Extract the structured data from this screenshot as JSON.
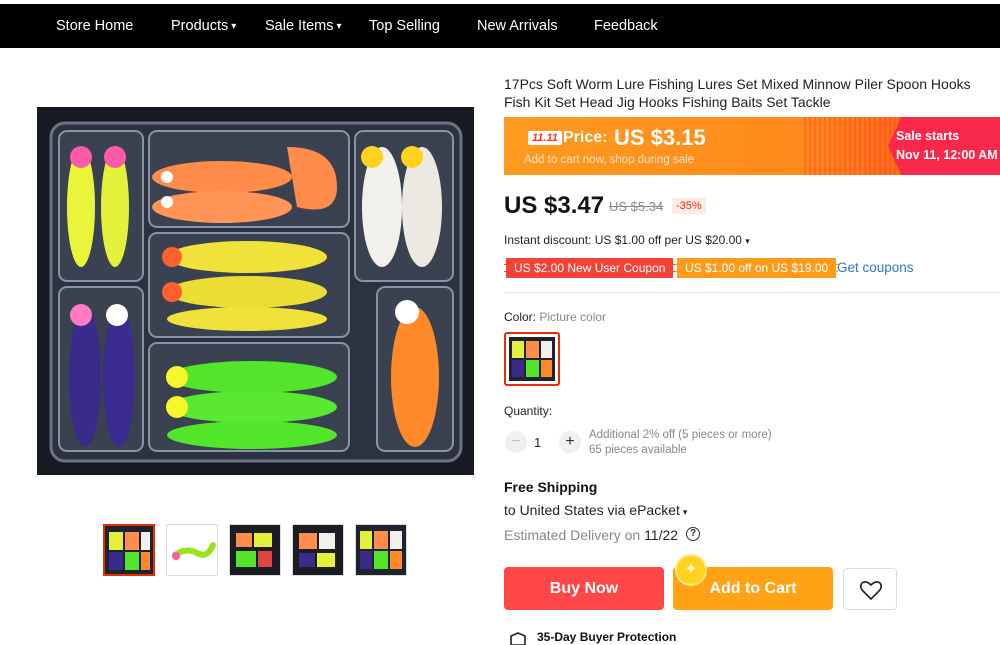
{
  "nav": {
    "items": [
      {
        "label": "Store Home",
        "dropdown": false
      },
      {
        "label": "Products",
        "dropdown": true
      },
      {
        "label": "Sale Items",
        "dropdown": true
      },
      {
        "label": "Top Selling",
        "dropdown": false
      },
      {
        "label": "New Arrivals",
        "dropdown": false
      },
      {
        "label": "Feedback",
        "dropdown": false
      }
    ]
  },
  "gallery": {
    "thumbnail_count": 5,
    "selected_index": 0
  },
  "product": {
    "title": "17Pcs Soft Worm Lure Fishing Lures Set Mixed Minnow Piler Spoon Hooks Fish Kit Set Head Jig Hooks Fishing Baits Set Tackle"
  },
  "promo_banner": {
    "tag": "11.11",
    "price_label": "Price:",
    "price": "US $3.15",
    "subtitle": "Add to cart now, shop during sale",
    "sale_starts_label": "Sale starts",
    "sale_starts_date": "Nov 11, 12:00 AM",
    "colors": {
      "orange": "#ff9a1f",
      "pink": "#f8284a"
    }
  },
  "pricing": {
    "current": "US $3.47",
    "original": "US $5.34",
    "discount": "-35%",
    "instant_discount": "Instant discount: US $1.00 off per US $20.00",
    "coupons": [
      "US $2.00 New User Coupon",
      "US $1.00 off on US $19.00"
    ],
    "get_coupons": "Get coupons"
  },
  "variant": {
    "color_label": "Color:",
    "color_value": "Picture color"
  },
  "quantity": {
    "label": "Quantity:",
    "value": "1",
    "note": "Additional 2% off (5 pieces or more)",
    "available": "65 pieces available"
  },
  "shipping": {
    "title": "Free Shipping",
    "destination": "to United States via ePacket",
    "delivery_label": "Estimated Delivery on",
    "delivery_date": "11/22"
  },
  "actions": {
    "buy_now": "Buy Now",
    "add_to_cart": "Add to Cart"
  },
  "protection": {
    "label": "35-Day Buyer Protection"
  },
  "colors": {
    "accent_red": "#ff4747",
    "accent_orange": "#ffa216",
    "link_blue": "#2d75c9"
  }
}
